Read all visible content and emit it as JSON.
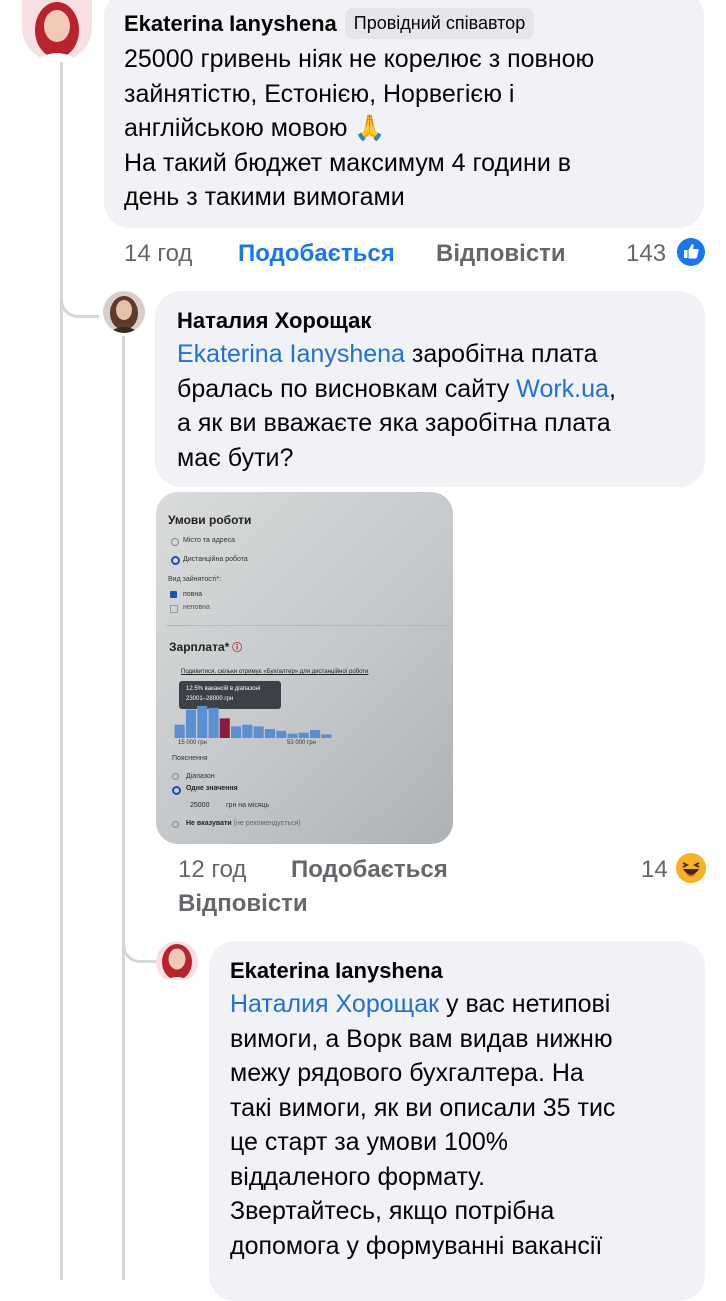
{
  "comments": [
    {
      "author": "Ekaterina Ianyshena",
      "badge": "Провідний співавтор",
      "lines": [
        "25000 гривень ніяк не корелює з повною",
        "зайнятістю, Естонією, Норвегією і",
        "англійською мовою 🙏",
        "На такий бюджет максимум 4 години в",
        "день з такими вимогами"
      ],
      "time": "14 год",
      "like_label": "Подобається",
      "reply_label": "Відповісти",
      "reaction_count": "143",
      "reaction_icon": "like-icon",
      "colors": {
        "like_active": "#1877f2"
      }
    },
    {
      "author": "Наталия Хорощак",
      "mention": "Ekaterina Ianyshena",
      "line1_rest": " заробітна плата",
      "line2_pre": "бралась по висновкам сайту ",
      "link": "Work.ua",
      "line2_post": ",",
      "line3": "а як ви вважаєте яка заробітна плата",
      "line4": "має бути?",
      "time": "12 год",
      "like_label": "Подобається",
      "reply_label": "Відповісти",
      "reaction_count": "14",
      "reaction_icon": "haha-icon",
      "photo": {
        "heading": "Умови роботи",
        "opt1": "Місто та адреса",
        "opt2": "Дистанційна робота",
        "employment_label": "Вид зайнятості*:",
        "emp1": "повна",
        "emp2": "неповна",
        "salary_heading": "Зарплата*",
        "salary_link": "Подивитися, скільки отримує «Бухгалтер» для дистанційної роботи",
        "tooltip_line1": "12.5% вакансій в діапазоні",
        "tooltip_line2": "23001–28000 грн",
        "axis_min": "15 000 грн",
        "axis_max": "53 000 грн",
        "note": "Пояснення",
        "range_opt": "Діапазон",
        "single_opt": "Одне значення",
        "value": "25000",
        "unit": "грн на місяць",
        "hide_opt": "Не вказувати",
        "hide_note": "(не рекомендується)",
        "chart_data": {
          "type": "bar",
          "title": "",
          "xlabel": "",
          "ylabel": "",
          "highlight_index": 4,
          "values": [
            1.5,
            3.2,
            3.6,
            3.4,
            2.2,
            1.3,
            1.5,
            1.3,
            1.0,
            0.8,
            0.5,
            0.6,
            0.9,
            0.4
          ]
        }
      }
    },
    {
      "author": "Ekaterina Ianyshena",
      "mention": "Наталия Хорощак",
      "line1_rest": " у вас нетипові",
      "lines": [
        "вимоги, а Ворк вам видав нижню",
        "межу рядового бухгалтера. На",
        "такі вимоги, як ви описали 35 тис",
        "це старт за умови 100%",
        "віддаленого формату.",
        "Звертайтесь, якщо потрібна",
        "допомога у формуванні вакансії"
      ]
    }
  ]
}
